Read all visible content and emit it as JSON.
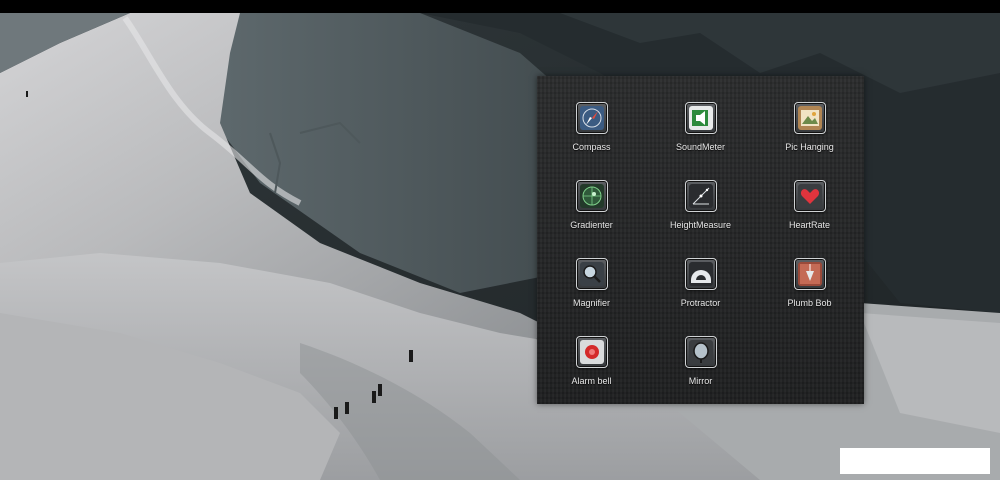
{
  "apps": [
    {
      "label": "Compass",
      "icon": "compass-icon"
    },
    {
      "label": "SoundMeter",
      "icon": "sound-meter-icon"
    },
    {
      "label": "Pic Hanging",
      "icon": "picture-frame-icon"
    },
    {
      "label": "Gradienter",
      "icon": "gradienter-icon"
    },
    {
      "label": "HeightMeasure",
      "icon": "height-measure-icon"
    },
    {
      "label": "HeartRate",
      "icon": "heart-icon"
    },
    {
      "label": "Magnifier",
      "icon": "magnifier-icon"
    },
    {
      "label": "Protractor",
      "icon": "protractor-icon"
    },
    {
      "label": "Plumb Bob",
      "icon": "plumb-bob-icon"
    },
    {
      "label": "Alarm bell",
      "icon": "alarm-bell-icon"
    },
    {
      "label": "Mirror",
      "icon": "mirror-icon"
    }
  ],
  "colors": {
    "panel_bg": "#252627",
    "label_text": "#e8e8e8",
    "heart": "#e0343d",
    "alarm": "#d42a2a",
    "gradienter_green": "#7fd18a"
  }
}
